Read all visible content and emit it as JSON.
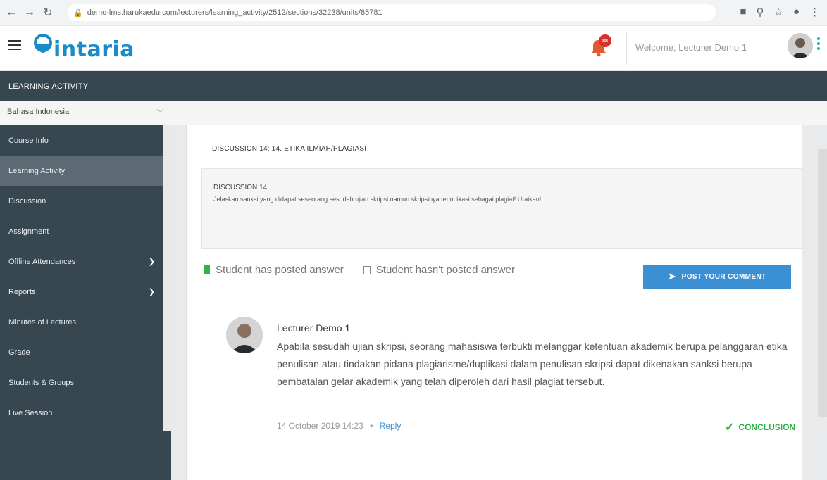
{
  "browser": {
    "url": "demo-lms.harukaedu.com/lecturers/learning_activity/2512/sections/32238/units/85781"
  },
  "header": {
    "logo_text": "intaria",
    "notification_count": "88",
    "welcome": "Welcome, Lecturer Demo 1"
  },
  "activity_bar": {
    "title": "LEARNING ACTIVITY"
  },
  "language": {
    "selected": "Bahasa Indonesia"
  },
  "sidebar": {
    "items": [
      {
        "label": "Course Info"
      },
      {
        "label": "Learning Activity"
      },
      {
        "label": "Discussion"
      },
      {
        "label": "Assignment"
      },
      {
        "label": "Offline Attendances"
      },
      {
        "label": "Reports"
      },
      {
        "label": "Minutes of Lectures"
      },
      {
        "label": "Grade"
      },
      {
        "label": "Students & Groups"
      },
      {
        "label": "Live Session"
      }
    ]
  },
  "discussion": {
    "title": "DISCUSSION 14: 14. ETIKA ILMIAH/PLAGIASI",
    "box_title": "DISCUSSION 14",
    "question": "Jelaskan sanksi yang didapat seseorang sesudah ujian skripsi namun skripsinya terindikasi sebagai plagiat! Uraikan!",
    "legend_posted": "Student has posted answer",
    "legend_not_posted": "Student hasn't posted answer",
    "post_button": "POST YOUR COMMENT"
  },
  "comment": {
    "author": "Lecturer Demo 1",
    "text": "Apabila sesudah ujian skripsi, seorang mahasiswa terbukti melanggar ketentuan akademik berupa pelanggaran etika penulisan atau tindakan pidana plagiarisme/duplikasi dalam penulisan skripsi dapat dikenakan sanksi berupa pembatalan gelar akademik yang telah diperoleh dari hasil plagiat tersebut.",
    "timestamp": "14 October 2019 14:23",
    "separator": "•",
    "reply": "Reply",
    "conclusion": "CONCLUSION"
  },
  "colors": {
    "brand": "#1a8ac9",
    "sidebar": "#37474f",
    "button": "#3b8fd3",
    "success": "#2db34a"
  }
}
